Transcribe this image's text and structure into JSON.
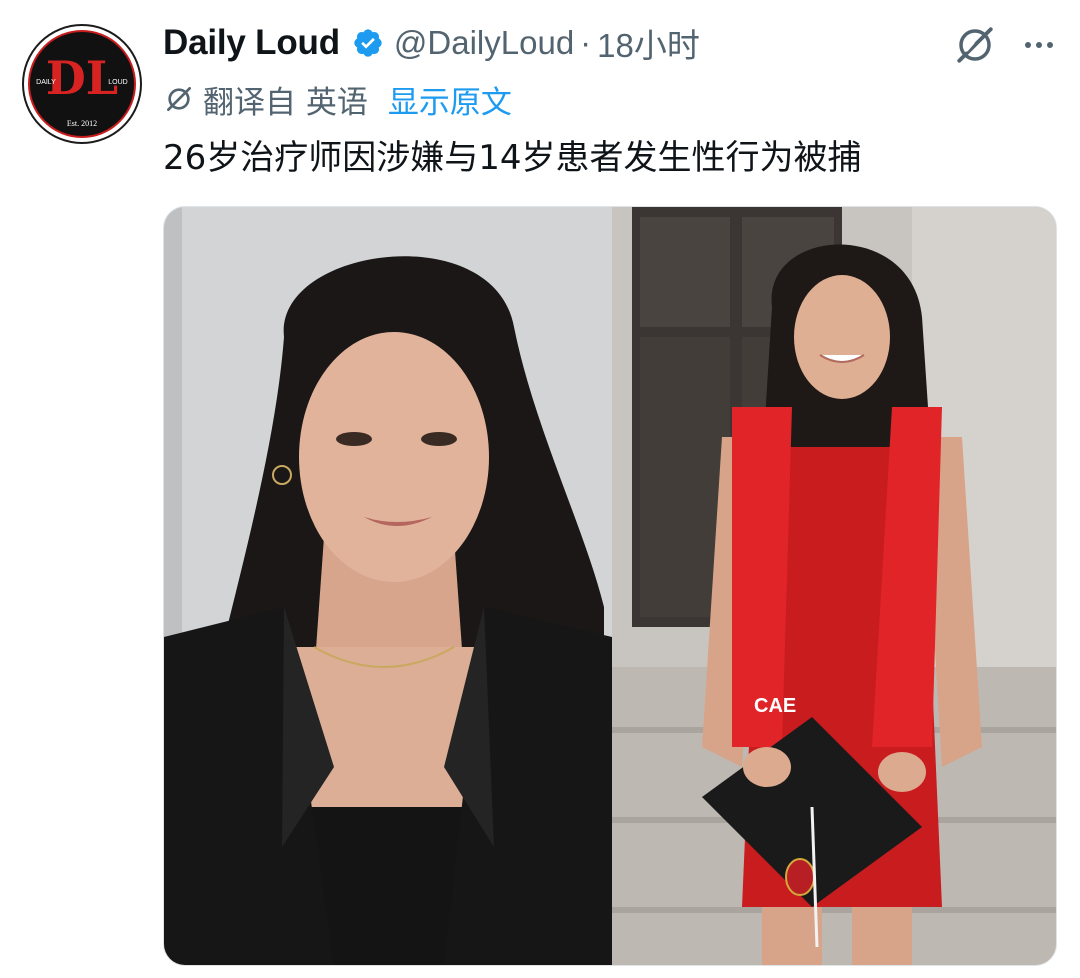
{
  "tweet": {
    "author": {
      "display_name": "Daily Loud",
      "handle": "@DailyLoud",
      "verified": true,
      "avatar": {
        "initials": "DL",
        "left_text": "DAILY",
        "right_text": "LOUD",
        "est_text": "Est. 2012"
      }
    },
    "separator": "·",
    "time": "18小时",
    "translation": {
      "translated_from": "翻译自 英语",
      "show_original": "显示原文"
    },
    "text": "26岁治疗师因涉嫌与14岁患者发生性行为被捕",
    "media": {
      "photo_count": 2,
      "right_photo_stole_text": "CAE"
    }
  },
  "icons": {
    "verified": "verified-badge-icon",
    "grok": "grok-icon",
    "more": "more-icon",
    "translate": "translate-icon"
  },
  "colors": {
    "text_primary": "#0f1419",
    "text_secondary": "#536471",
    "link_blue": "#1d9bf0",
    "brand_red": "#c81d1d"
  }
}
